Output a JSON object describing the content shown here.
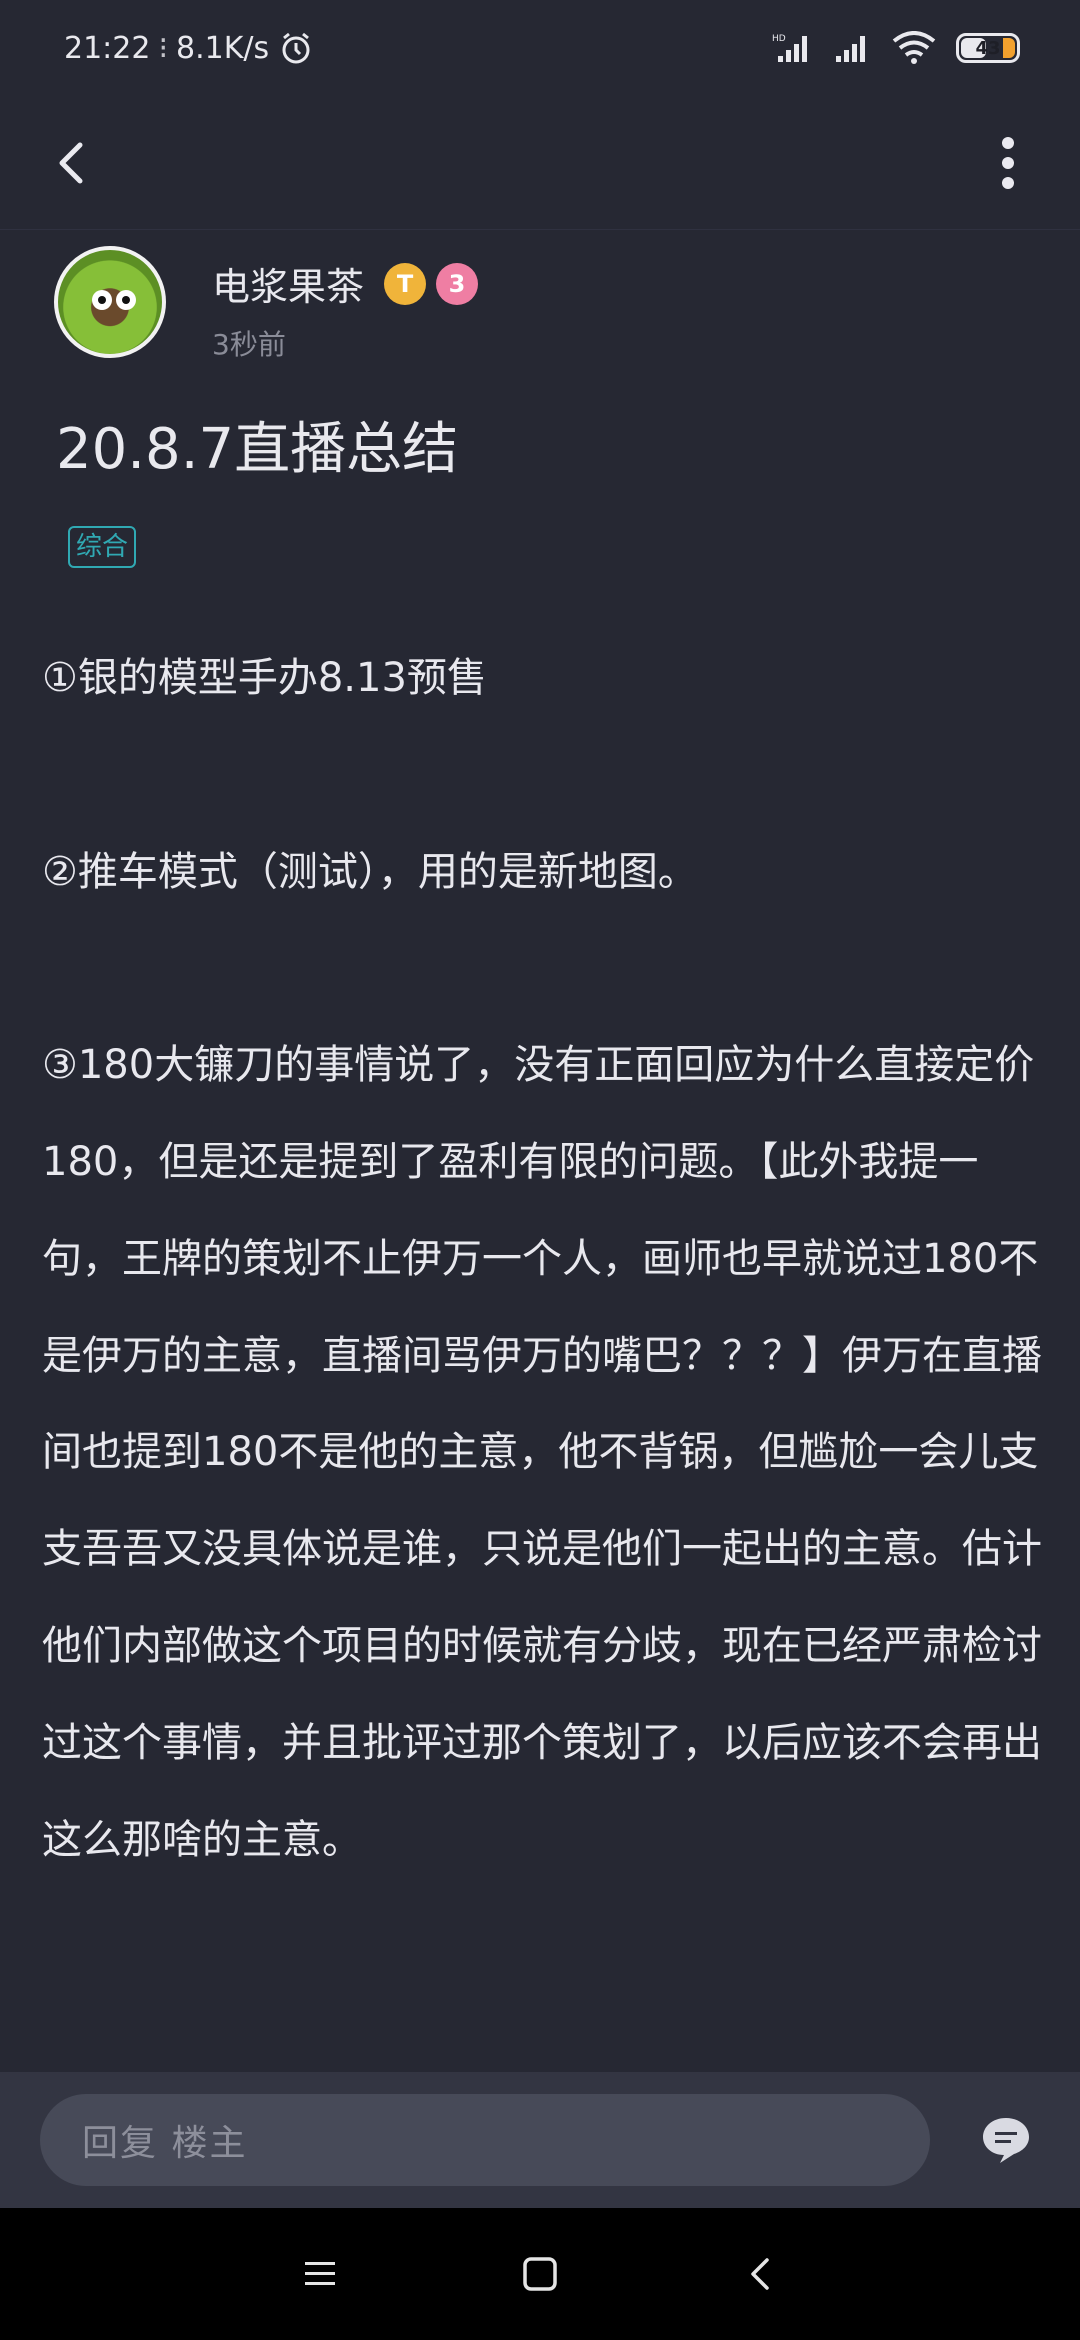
{
  "status_bar": {
    "time": "21:22",
    "net_speed": "8.1K/s",
    "battery": "43",
    "battery_level": 0.43
  },
  "author": {
    "name": "电浆果茶",
    "time": "3秒前",
    "badge_t": "T",
    "badge_s": "3"
  },
  "post": {
    "title": "20.8.7直播总结",
    "category": "综合",
    "paragraphs": [
      "①银的模型手办8.13预售",
      "②推车模式（测试），用的是新地图。",
      "③180大镰刀的事情说了，没有正面回应为什么直接定价180，但是还是提到了盈利有限的问题。【此外我提一句，王牌的策划不止伊万一个人，画师也早就说过180不是伊万的主意，直播间骂伊万的嘴巴？？？】伊万在直播间也提到180不是他的主意，他不背锅，但尴尬一会儿支支吾吾又没具体说是谁，只说是他们一起出的主意。估计他们内部做这个项目的时候就有分歧，现在已经严肃检讨过这个事情，并且批评过那个策划了，以后应该不会再出这么那啥的主意。"
    ]
  },
  "reply": {
    "placeholder": "回复  楼主"
  },
  "colors": {
    "background": "#262833",
    "accent_tag": "#30a9b3",
    "reply_bar": "#333542",
    "badge_t": "#f0b43a",
    "badge_s": "#ef7ea3"
  },
  "icons": [
    "back-arrow-icon",
    "more-vert-icon",
    "alarm-icon",
    "signal-icon",
    "wifi-icon",
    "comment-icon",
    "menu-icon",
    "home-square-icon",
    "back-triangle-icon"
  ]
}
